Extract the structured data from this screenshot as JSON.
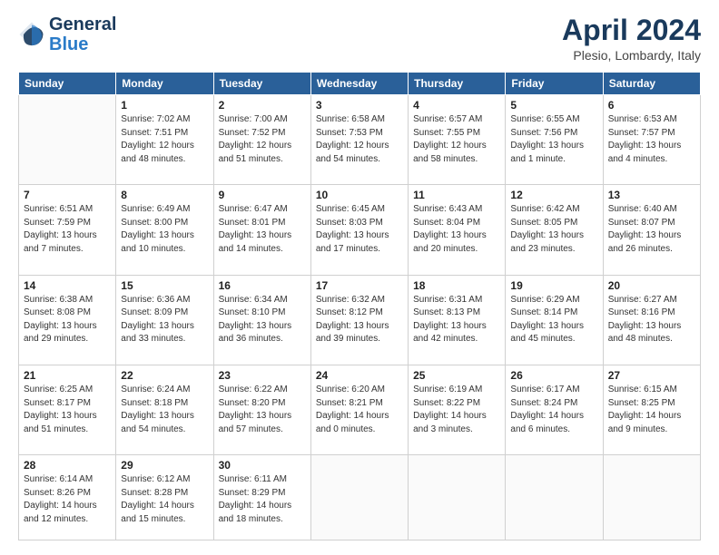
{
  "header": {
    "logo_line1": "General",
    "logo_line2": "Blue",
    "main_title": "April 2024",
    "subtitle": "Plesio, Lombardy, Italy"
  },
  "calendar": {
    "headers": [
      "Sunday",
      "Monday",
      "Tuesday",
      "Wednesday",
      "Thursday",
      "Friday",
      "Saturday"
    ],
    "rows": [
      [
        {
          "day": "",
          "info": ""
        },
        {
          "day": "1",
          "info": "Sunrise: 7:02 AM\nSunset: 7:51 PM\nDaylight: 12 hours\nand 48 minutes."
        },
        {
          "day": "2",
          "info": "Sunrise: 7:00 AM\nSunset: 7:52 PM\nDaylight: 12 hours\nand 51 minutes."
        },
        {
          "day": "3",
          "info": "Sunrise: 6:58 AM\nSunset: 7:53 PM\nDaylight: 12 hours\nand 54 minutes."
        },
        {
          "day": "4",
          "info": "Sunrise: 6:57 AM\nSunset: 7:55 PM\nDaylight: 12 hours\nand 58 minutes."
        },
        {
          "day": "5",
          "info": "Sunrise: 6:55 AM\nSunset: 7:56 PM\nDaylight: 13 hours\nand 1 minute."
        },
        {
          "day": "6",
          "info": "Sunrise: 6:53 AM\nSunset: 7:57 PM\nDaylight: 13 hours\nand 4 minutes."
        }
      ],
      [
        {
          "day": "7",
          "info": "Sunrise: 6:51 AM\nSunset: 7:59 PM\nDaylight: 13 hours\nand 7 minutes."
        },
        {
          "day": "8",
          "info": "Sunrise: 6:49 AM\nSunset: 8:00 PM\nDaylight: 13 hours\nand 10 minutes."
        },
        {
          "day": "9",
          "info": "Sunrise: 6:47 AM\nSunset: 8:01 PM\nDaylight: 13 hours\nand 14 minutes."
        },
        {
          "day": "10",
          "info": "Sunrise: 6:45 AM\nSunset: 8:03 PM\nDaylight: 13 hours\nand 17 minutes."
        },
        {
          "day": "11",
          "info": "Sunrise: 6:43 AM\nSunset: 8:04 PM\nDaylight: 13 hours\nand 20 minutes."
        },
        {
          "day": "12",
          "info": "Sunrise: 6:42 AM\nSunset: 8:05 PM\nDaylight: 13 hours\nand 23 minutes."
        },
        {
          "day": "13",
          "info": "Sunrise: 6:40 AM\nSunset: 8:07 PM\nDaylight: 13 hours\nand 26 minutes."
        }
      ],
      [
        {
          "day": "14",
          "info": "Sunrise: 6:38 AM\nSunset: 8:08 PM\nDaylight: 13 hours\nand 29 minutes."
        },
        {
          "day": "15",
          "info": "Sunrise: 6:36 AM\nSunset: 8:09 PM\nDaylight: 13 hours\nand 33 minutes."
        },
        {
          "day": "16",
          "info": "Sunrise: 6:34 AM\nSunset: 8:10 PM\nDaylight: 13 hours\nand 36 minutes."
        },
        {
          "day": "17",
          "info": "Sunrise: 6:32 AM\nSunset: 8:12 PM\nDaylight: 13 hours\nand 39 minutes."
        },
        {
          "day": "18",
          "info": "Sunrise: 6:31 AM\nSunset: 8:13 PM\nDaylight: 13 hours\nand 42 minutes."
        },
        {
          "day": "19",
          "info": "Sunrise: 6:29 AM\nSunset: 8:14 PM\nDaylight: 13 hours\nand 45 minutes."
        },
        {
          "day": "20",
          "info": "Sunrise: 6:27 AM\nSunset: 8:16 PM\nDaylight: 13 hours\nand 48 minutes."
        }
      ],
      [
        {
          "day": "21",
          "info": "Sunrise: 6:25 AM\nSunset: 8:17 PM\nDaylight: 13 hours\nand 51 minutes."
        },
        {
          "day": "22",
          "info": "Sunrise: 6:24 AM\nSunset: 8:18 PM\nDaylight: 13 hours\nand 54 minutes."
        },
        {
          "day": "23",
          "info": "Sunrise: 6:22 AM\nSunset: 8:20 PM\nDaylight: 13 hours\nand 57 minutes."
        },
        {
          "day": "24",
          "info": "Sunrise: 6:20 AM\nSunset: 8:21 PM\nDaylight: 14 hours\nand 0 minutes."
        },
        {
          "day": "25",
          "info": "Sunrise: 6:19 AM\nSunset: 8:22 PM\nDaylight: 14 hours\nand 3 minutes."
        },
        {
          "day": "26",
          "info": "Sunrise: 6:17 AM\nSunset: 8:24 PM\nDaylight: 14 hours\nand 6 minutes."
        },
        {
          "day": "27",
          "info": "Sunrise: 6:15 AM\nSunset: 8:25 PM\nDaylight: 14 hours\nand 9 minutes."
        }
      ],
      [
        {
          "day": "28",
          "info": "Sunrise: 6:14 AM\nSunset: 8:26 PM\nDaylight: 14 hours\nand 12 minutes."
        },
        {
          "day": "29",
          "info": "Sunrise: 6:12 AM\nSunset: 8:28 PM\nDaylight: 14 hours\nand 15 minutes."
        },
        {
          "day": "30",
          "info": "Sunrise: 6:11 AM\nSunset: 8:29 PM\nDaylight: 14 hours\nand 18 minutes."
        },
        {
          "day": "",
          "info": ""
        },
        {
          "day": "",
          "info": ""
        },
        {
          "day": "",
          "info": ""
        },
        {
          "day": "",
          "info": ""
        }
      ]
    ]
  }
}
